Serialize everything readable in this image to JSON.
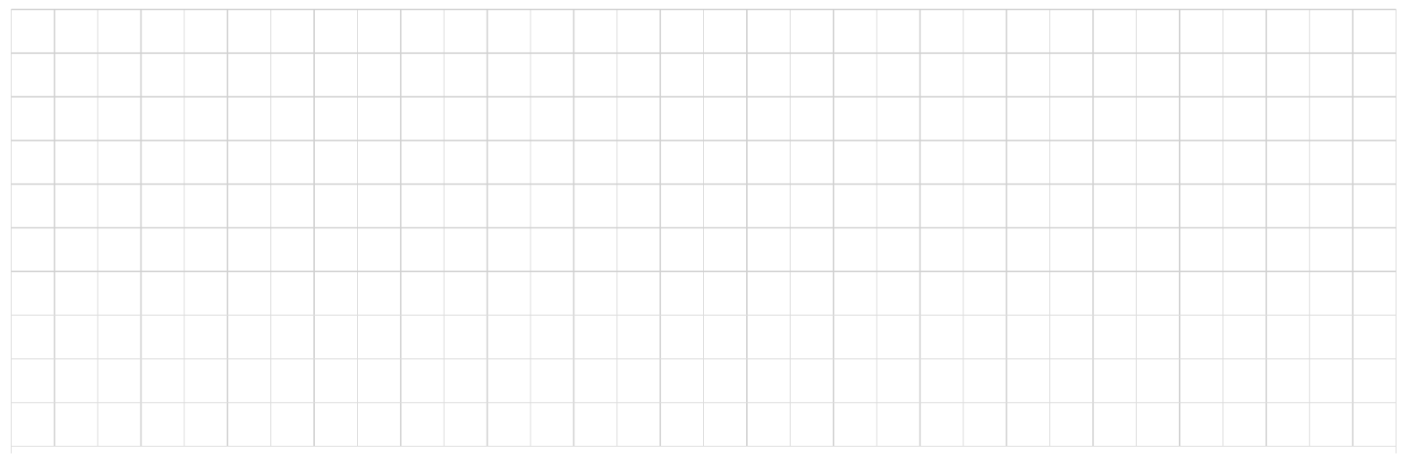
{
  "grid": {
    "columns": 32,
    "rows": 10,
    "line_color": "#dcdcdc",
    "line_color_strong": "#d0d0d0",
    "background": "#ffffff",
    "cells_empty": true
  }
}
